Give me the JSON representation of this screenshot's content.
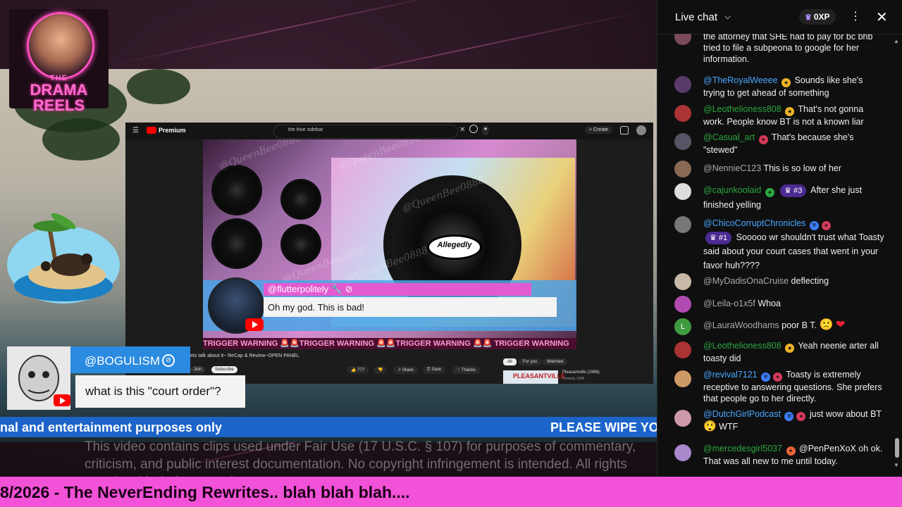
{
  "logo": {
    "line1": "THE",
    "line2": "DRAMA",
    "line3": "REELS"
  },
  "inner_youtube": {
    "brand": "Premium",
    "search_value": "the hive sidebar",
    "create_label": "Create",
    "featured": {
      "username": "@flutterpolitely",
      "message": "Oh my god. This is bad!"
    },
    "trigger_warning": "TRIGGER WARNING 🚨🚨TRIGGER WARNING 🚨🚨TRIGGER WARNING 🚨🚨 TRIGGER WARNING",
    "video_title": "ets talk about it~ ReCap & Review~OPEN PANEL",
    "join_label": "Join",
    "subscribe_label": "Subscribe",
    "like_count": "777",
    "share_label": "Share",
    "save_label": "Save",
    "thanks_label": "Thanks",
    "chips": [
      "All",
      "For you",
      "Watched"
    ],
    "sidebar_video_title": "Pleasantville (1998)",
    "sidebar_video_sub": "Comedy 1998",
    "sidebar_thumb_text": "PLEASANTVILLE",
    "watermark": "@QueenBee0888",
    "disc_label": "Allegedly"
  },
  "comment_card": {
    "username": "@BOGULISM",
    "message": "what is this \"court order\"?"
  },
  "ticker": {
    "left": "nal and entertainment purposes only",
    "right": "PLEASE WIPE YO"
  },
  "disclaimer": "This video contains clips used under Fair Use (17 U.S.C. § 107) for purposes of commentary, criticism, and public interest documentation. No copyright infringement is intended. All rights remain with their respective",
  "banner": "8/2026 - The NeverEnding Rewrites.. blah blah blah....",
  "chat": {
    "title": "Live chat",
    "xp": "0XP",
    "messages": [
      {
        "author": "",
        "text": "the attorney that SHE had to pay for bc bhb tried to file a subpeona to google for her information."
      },
      {
        "author": "@TheRoyalWeeee",
        "text": "Sounds like she's trying to get ahead of something"
      },
      {
        "author": "@Leothelioness808",
        "text": "That's not gonna work. People know BT is not a known liar"
      },
      {
        "author": "@Casual_art",
        "text": "That's because she's \"stewed\""
      },
      {
        "author": "@NennieC123",
        "text": "This is so low of her"
      },
      {
        "author": "@cajunkoolaid",
        "rank": "#3",
        "text": "After she just finished yelling"
      },
      {
        "author": "@ChicoCorruptChronicles",
        "rank": "#1",
        "text": "Sooooo wr shouldn't trust what Toasty said about your court cases that went in your favor huh????"
      },
      {
        "author": "@MyDadisOnaCruise",
        "text": "deflecting"
      },
      {
        "author": "@Leila-o1x5f",
        "text": "Whoa"
      },
      {
        "author": "@LauraWoodhams",
        "text": "poor B T."
      },
      {
        "author": "@Leothelioness808",
        "text": "Yeah neenie arter all toasty did"
      },
      {
        "author": "@revival7121",
        "text": "Toasty is extremely receptive to answering questions. She prefers that people go to her directly."
      },
      {
        "author": "@DutchGirlPodcast",
        "text": "just wow about BT",
        "suffix": "WTF"
      },
      {
        "author": "@mercedesgirl5037",
        "text": "@PenPenXoX oh ok. That was all new to me until today."
      }
    ]
  },
  "colors": {
    "chat_author": "#49a8ff",
    "ticker_bg": "#1c64c9",
    "banner_bg": "#f252d7",
    "featured_namebar": "#e35ad0"
  }
}
